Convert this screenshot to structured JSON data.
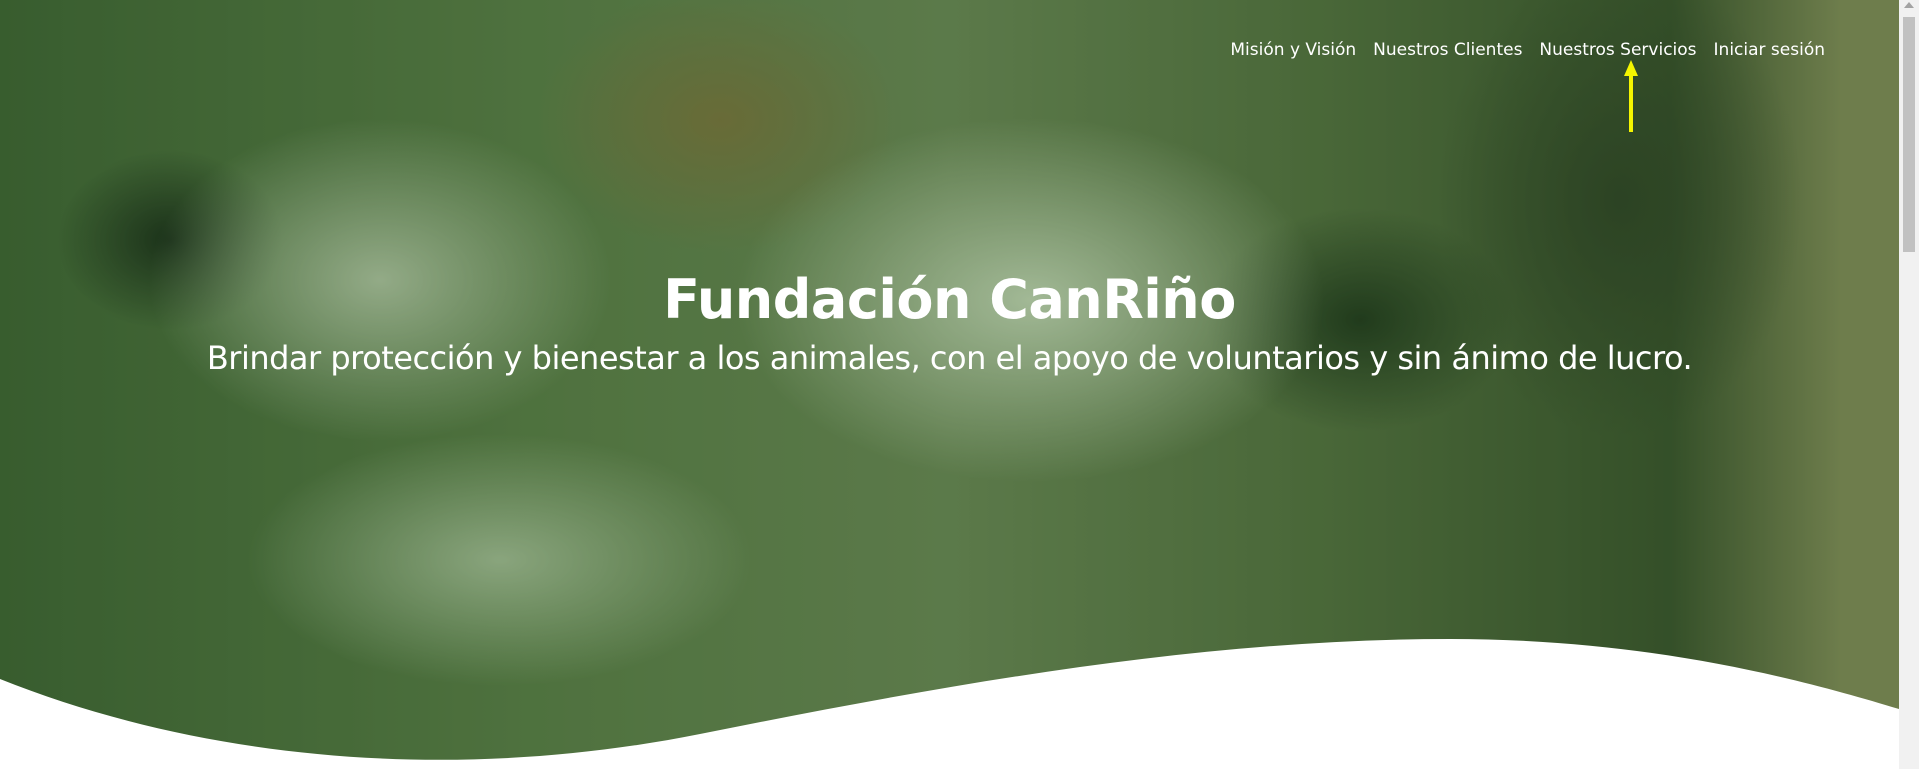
{
  "nav": {
    "items": [
      {
        "label": "Misión y Visión"
      },
      {
        "label": "Nuestros Clientes"
      },
      {
        "label": "Nuestros Servicios"
      },
      {
        "label": "Iniciar sesión"
      }
    ]
  },
  "hero": {
    "title": "Fundación CanRiño",
    "subtitle": "Brindar protección y bienestar a los animales, con el apoyo de voluntarios y sin ánimo de lucro.",
    "overlay_color": "#2f6b2a",
    "wave_color": "#ffffff"
  },
  "cursor": {
    "icon": "yellow-arrow-cursor-icon",
    "color": "#f5f500"
  },
  "scrollbar": {
    "track_color": "#f1f1f1",
    "thumb_color": "#c1c1c1"
  }
}
